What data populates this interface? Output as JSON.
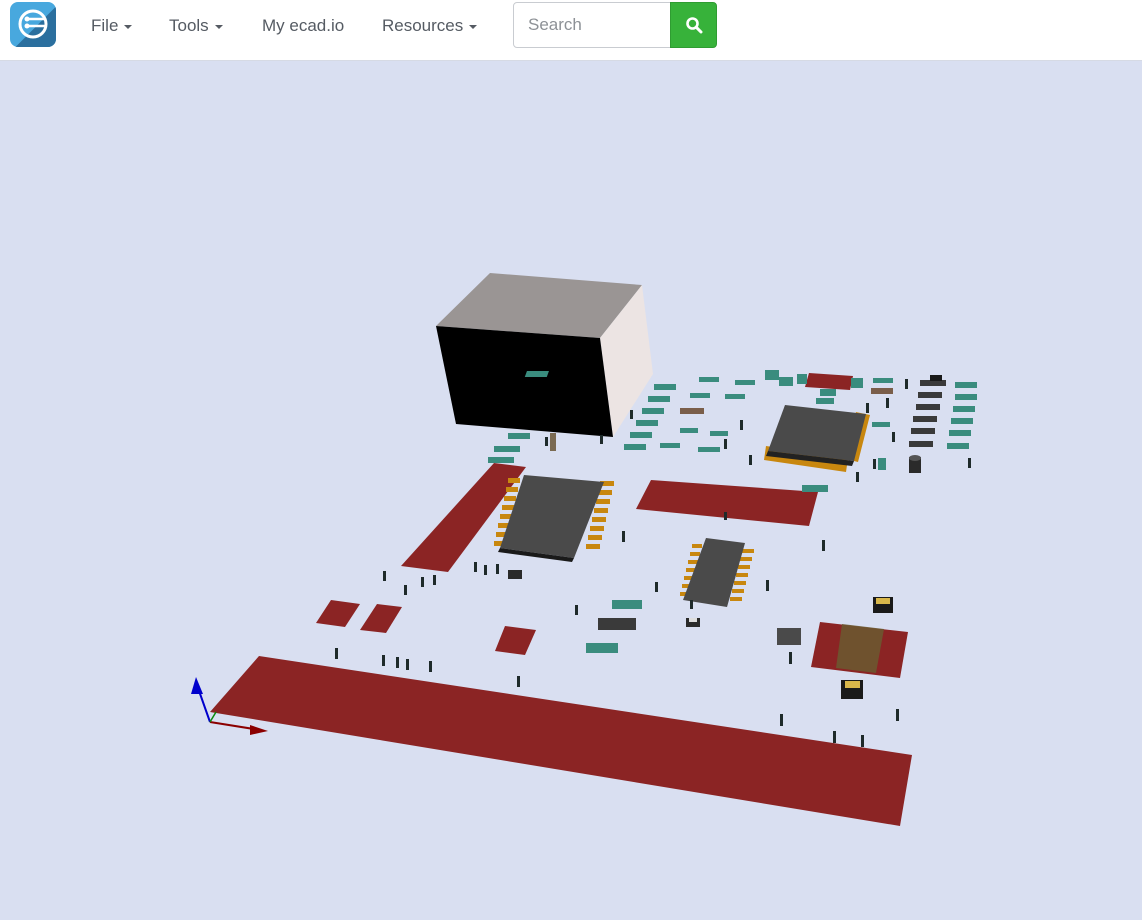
{
  "navbar": {
    "logo_icon": "ecad-circuit-logo-icon",
    "menu": [
      {
        "label": "File",
        "has_dropdown": true
      },
      {
        "label": "Tools",
        "has_dropdown": true
      },
      {
        "label": "My ecad.io",
        "has_dropdown": false
      },
      {
        "label": "Resources",
        "has_dropdown": true
      }
    ],
    "search": {
      "placeholder": "Search",
      "value": "",
      "button_icon": "search-icon"
    }
  },
  "viewer": {
    "background_color": "#d9dff1",
    "board_colors": {
      "pad": "#8b2424",
      "ic_body": "#4a4a4a",
      "ic_pin": "#c8870f",
      "smd": "#3a8c7e"
    },
    "axes": [
      "x",
      "y",
      "z"
    ]
  },
  "colors": {
    "accent_green": "#37b23a",
    "logo_blue": "#48a8de"
  }
}
